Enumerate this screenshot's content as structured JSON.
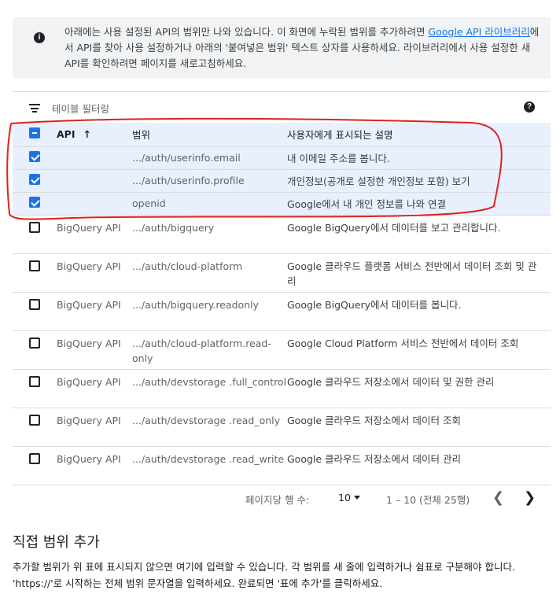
{
  "info": {
    "text_before_link": "아래에는 사용 설정된 API의 범위만 나와 있습니다. 이 화면에 누락된 범위를 추가하려면 ",
    "link": "Google API 라이브러리",
    "text_after_link": "에서 API를 찾아 사용 설정하거나 아래의 '붙여넣은 범위' 텍스트 상자를 사용하세요. 라이브러리에서 사용 설정한 새 API를 확인하려면 페이지를 새로고침하세요."
  },
  "filter": {
    "placeholder": "테이블 필터링"
  },
  "table": {
    "headers": {
      "api": "API",
      "scope": "범위",
      "desc": "사용자에게 표시되는 설명"
    },
    "rows": [
      {
        "api": "",
        "scope": ".../auth/userinfo.email",
        "desc": "내 이메일 주소를 봅니다.",
        "checked": true
      },
      {
        "api": "",
        "scope": ".../auth/userinfo.profile",
        "desc": "개인정보(공개로 설정한 개인정보 포함) 보기",
        "checked": true
      },
      {
        "api": "",
        "scope": "openid",
        "desc": "Google에서 내 개인 정보를 나와 연결",
        "checked": true
      },
      {
        "api": "BigQuery API",
        "scope": ".../auth/bigquery",
        "desc": "Google BigQuery에서 데이터를 보고 관리합니다.",
        "checked": false
      },
      {
        "api": "BigQuery API",
        "scope": ".../auth/cloud-platform",
        "desc": "Google 클라우드 플랫폼 서비스 전반에서 데이터 조회 및 관리",
        "checked": false
      },
      {
        "api": "BigQuery API",
        "scope": ".../auth/bigquery.readonly",
        "desc": "Google BigQuery에서 데이터를 봅니다.",
        "checked": false
      },
      {
        "api": "BigQuery API",
        "scope": ".../auth/cloud-platform.read-only",
        "desc": "Google Cloud Platform 서비스 전반에서 데이터 조회",
        "checked": false
      },
      {
        "api": "BigQuery API",
        "scope": ".../auth/devstorage .full_control",
        "desc": "Google 클라우드 저장소에서 데이터 및 권한 관리",
        "checked": false
      },
      {
        "api": "BigQuery API",
        "scope": ".../auth/devstorage .read_only",
        "desc": "Google 클라우드 저장소에서 데이터 조회",
        "checked": false
      },
      {
        "api": "BigQuery API",
        "scope": ".../auth/devstorage .read_write",
        "desc": "Google 클라우드 저장소에서 데이터 관리",
        "checked": false
      }
    ]
  },
  "pager": {
    "rows_per_page_label": "페이지당 행 수:",
    "rows_per_page": "10",
    "range": "1 – 10 (전체 25행)"
  },
  "manual": {
    "title": "직접 범위 추가",
    "text": "추가할 범위가 위 표에 표시되지 않으면 여기에 입력할 수 있습니다. 각 범위를 새 줄에 입력하거나 쉼표로 구분해야 합니다. 'https://'로 시작하는 전체 범위 문자열을 입력하세요. 완료되면 '표에 추가'를 클릭하세요."
  },
  "colors": {
    "accent": "#1a73e8",
    "annotation": "#e0201c",
    "selected_row": "#e8f0fe"
  }
}
